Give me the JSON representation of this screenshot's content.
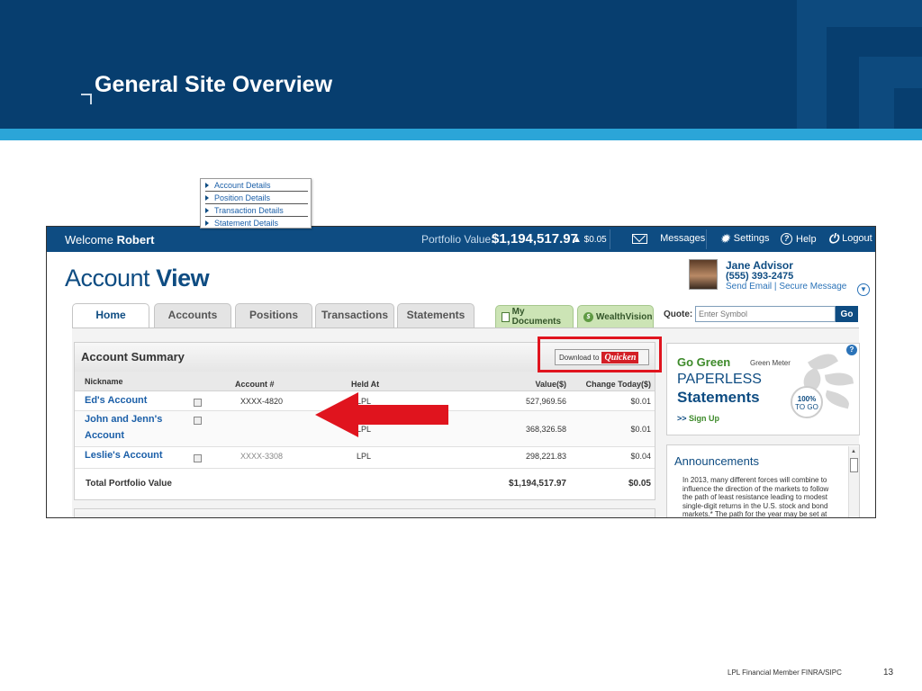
{
  "slide": {
    "title": "General Site Overview",
    "footer": "LPL Financial   Member FINRA/SIPC",
    "page_number": "13",
    "colors": {
      "header": "#073e6f",
      "stripe": "#2ba5d8",
      "highlight": "#e0141e"
    }
  },
  "topbar": {
    "welcome_label": "Welcome",
    "user_name": "Robert",
    "portfolio_label": "Portfolio Value:",
    "portfolio_value": "$1,194,517.97",
    "portfolio_change": "▲ $0.05",
    "messages": "Messages",
    "settings": "Settings",
    "help": "Help",
    "logout": "Logout"
  },
  "brand": {
    "title_light": "Account",
    "title_bold": "View"
  },
  "advisor": {
    "name": "Jane Advisor",
    "phone": "(555) 393-2475",
    "send_email": "Send Email",
    "separator": "|",
    "secure_message": "Secure Message"
  },
  "tabs": [
    {
      "label": "Home",
      "active": true
    },
    {
      "label": "Accounts"
    },
    {
      "label": "Positions"
    },
    {
      "label": "Transactions"
    },
    {
      "label": "Statements"
    }
  ],
  "green_tabs": {
    "documents": "My Documents",
    "wealthvision": "WealthVision"
  },
  "quote": {
    "label": "Quote:",
    "placeholder": "Enter Symbol",
    "go": "Go"
  },
  "summary": {
    "title": "Account Summary",
    "download_label": "Download to",
    "download_brand": "Quicken",
    "columns": [
      "Nickname",
      "Account #",
      "Held At",
      "Value($)",
      "Change Today($)"
    ],
    "rows": [
      {
        "nickname": "Ed's Account",
        "account": "XXXX-4820",
        "held_at": "LPL",
        "value": "527,969.56",
        "change": "$0.01"
      },
      {
        "nickname_line1": "John and Jenn's",
        "nickname_line2": "Account",
        "account": "",
        "held_at": "LPL",
        "value": "368,326.58",
        "change": "$0.01"
      },
      {
        "nickname": "Leslie's Account",
        "account": "XXXX-3308",
        "held_at": "LPL",
        "value": "298,221.83",
        "change": "$0.04"
      }
    ],
    "total_label": "Total Portfolio Value",
    "total_value": "$1,194,517.97",
    "total_change": "$0.05"
  },
  "context_menu": [
    "Account Details",
    "Position Details",
    "Transaction Details",
    "Statement Details"
  ],
  "go_green": {
    "title": "Go Green",
    "meter_label": "Green Meter",
    "paperless": "PAPERLESS",
    "statements": "Statements",
    "signup_prefix": ">>",
    "signup": "Sign Up",
    "percent": "100%",
    "to_go": "TO GO"
  },
  "announcements": {
    "title": "Announcements",
    "text": "In 2013, many different forces will combine to influence the direction of the markets to follow the path of least resistance leading to modest single-digit returns in the U.S. stock and bond markets.* The path for the year may be set at"
  }
}
